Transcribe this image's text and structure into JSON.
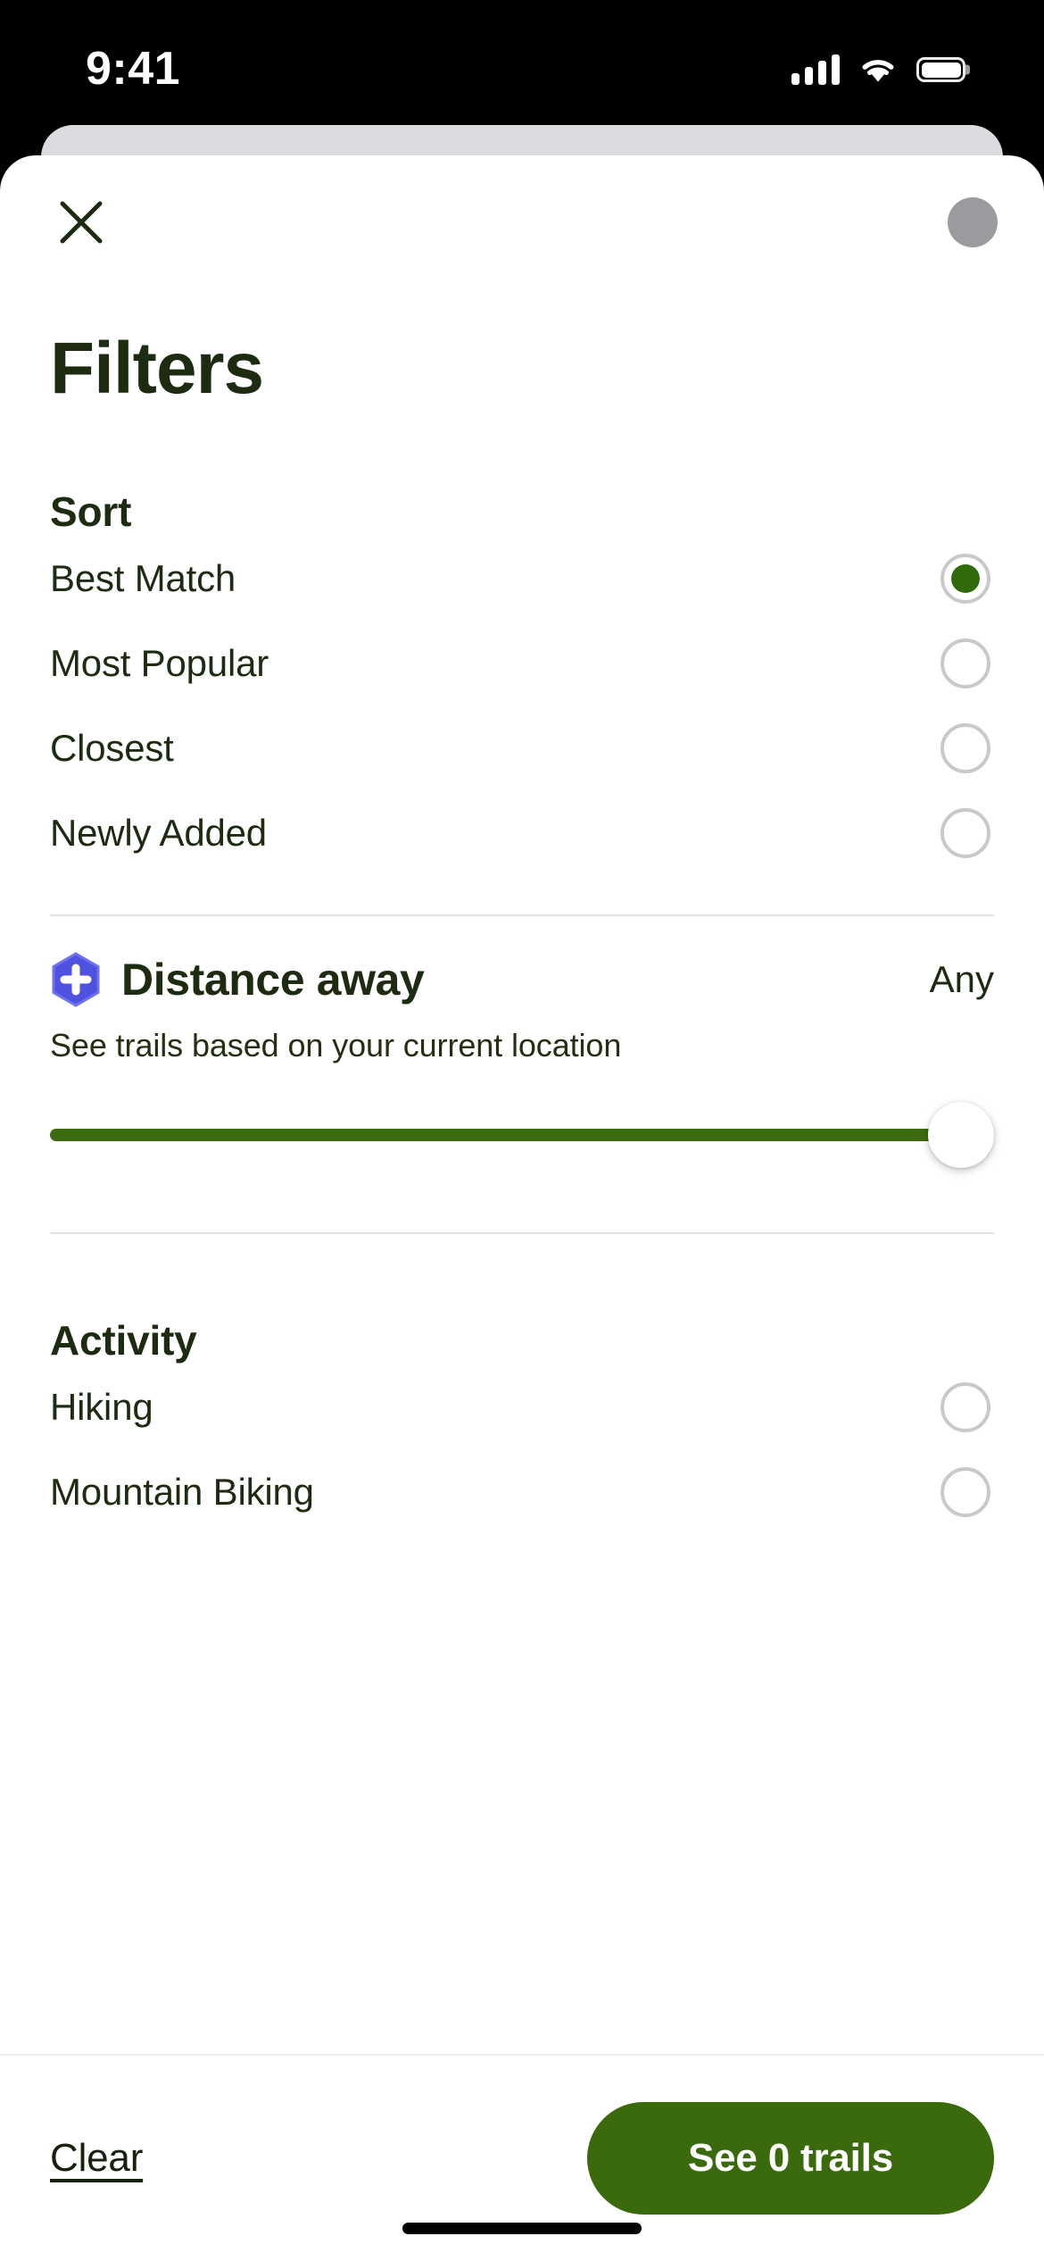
{
  "status_bar": {
    "time": "9:41",
    "signal_icon": "cellular-signal-icon",
    "wifi_icon": "wifi-icon",
    "battery_icon": "battery-full-icon"
  },
  "header": {
    "close_icon": "close-x-icon",
    "avatar_label": "avatar"
  },
  "page": {
    "title": "Filters"
  },
  "sort": {
    "heading": "Sort",
    "options": [
      {
        "label": "Best Match",
        "selected": true
      },
      {
        "label": "Most Popular",
        "selected": false
      },
      {
        "label": "Closest",
        "selected": false
      },
      {
        "label": "Newly Added",
        "selected": false
      }
    ]
  },
  "distance": {
    "badge_icon": "pro-plus-hexagon-badge-icon",
    "title": "Distance away",
    "value": "Any",
    "subtitle": "See trails based on your current location",
    "slider": {
      "percent": 100,
      "fill_color": "#3d6b0f",
      "thumb_color": "#ffffff"
    }
  },
  "activity": {
    "heading": "Activity",
    "options": [
      {
        "label": "Hiking",
        "selected": false
      },
      {
        "label": "Mountain Biking",
        "selected": false
      }
    ]
  },
  "footer": {
    "clear_label": "Clear",
    "cta_label": "See 0 trails",
    "cta_color": "#3a6a0c"
  },
  "colors": {
    "primary_text": "#1d2c10",
    "accent_green": "#2f6b0b",
    "badge_purple": "#4f52e0",
    "radio_border": "#c9c9c9"
  }
}
